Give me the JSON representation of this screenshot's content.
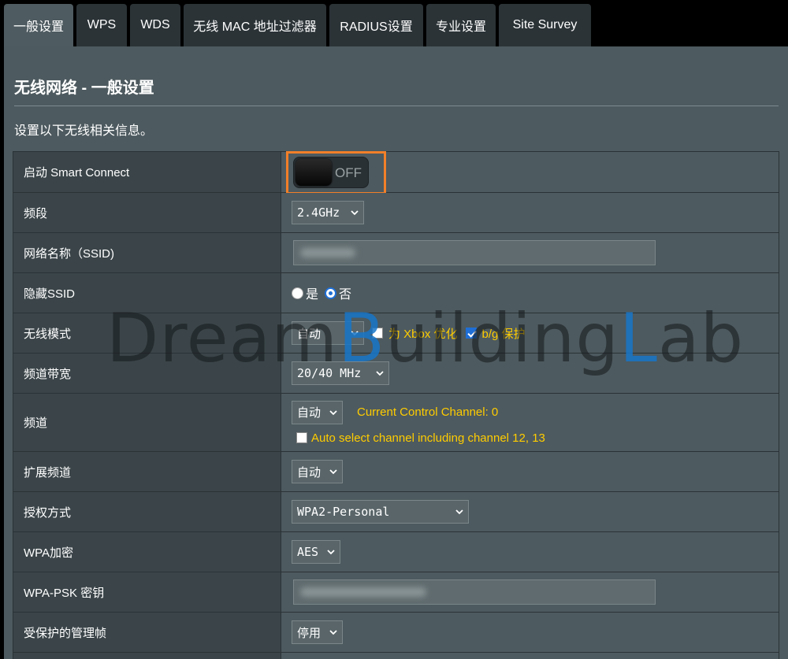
{
  "tabs": [
    {
      "label": "一般设置",
      "active": true
    },
    {
      "label": "WPS",
      "active": false
    },
    {
      "label": "WDS",
      "active": false
    },
    {
      "label": "无线 MAC 地址过滤器",
      "active": false
    },
    {
      "label": "RADIUS设置",
      "active": false
    },
    {
      "label": "专业设置",
      "active": false
    },
    {
      "label": "Site Survey",
      "active": false
    }
  ],
  "page": {
    "title": "无线网络 - 一般设置",
    "description": "设置以下无线相关信息。"
  },
  "rows": {
    "smart_connect": {
      "label": "启动 Smart Connect",
      "toggle_text": "OFF"
    },
    "band": {
      "label": "频段",
      "value": "2.4GHz"
    },
    "ssid": {
      "label": "网络名称（SSID)",
      "value": ""
    },
    "hide_ssid": {
      "label": "隐藏SSID",
      "yes": "是",
      "no": "否",
      "selected": "否"
    },
    "wireless_mode": {
      "label": "无线模式",
      "value": "自动",
      "xbox_label": "为 Xbox 优化",
      "bg_label": "b/g 保护"
    },
    "bandwidth": {
      "label": "频道带宽",
      "value": "20/40 MHz"
    },
    "channel": {
      "label": "频道",
      "value": "自动",
      "current": "Current Control Channel: 0",
      "auto_label": "Auto select channel including channel 12, 13"
    },
    "ext_channel": {
      "label": "扩展频道",
      "value": "自动"
    },
    "auth": {
      "label": "授权方式",
      "value": "WPA2-Personal"
    },
    "wpa_enc": {
      "label": "WPA加密",
      "value": "AES"
    },
    "psk": {
      "label": "WPA-PSK 密钥",
      "value": ""
    },
    "pmf": {
      "label": "受保护的管理帧",
      "value": "停用"
    }
  },
  "watermark": {
    "p1": "Dream",
    "p2": "B",
    "p3": "uilding",
    "p4": "L",
    "p5": "ab"
  },
  "colors": {
    "accent": "#f27f28",
    "highlight_text": "#ffcc00",
    "panel": "#4d5a5f",
    "label_cell": "#3b4549"
  }
}
